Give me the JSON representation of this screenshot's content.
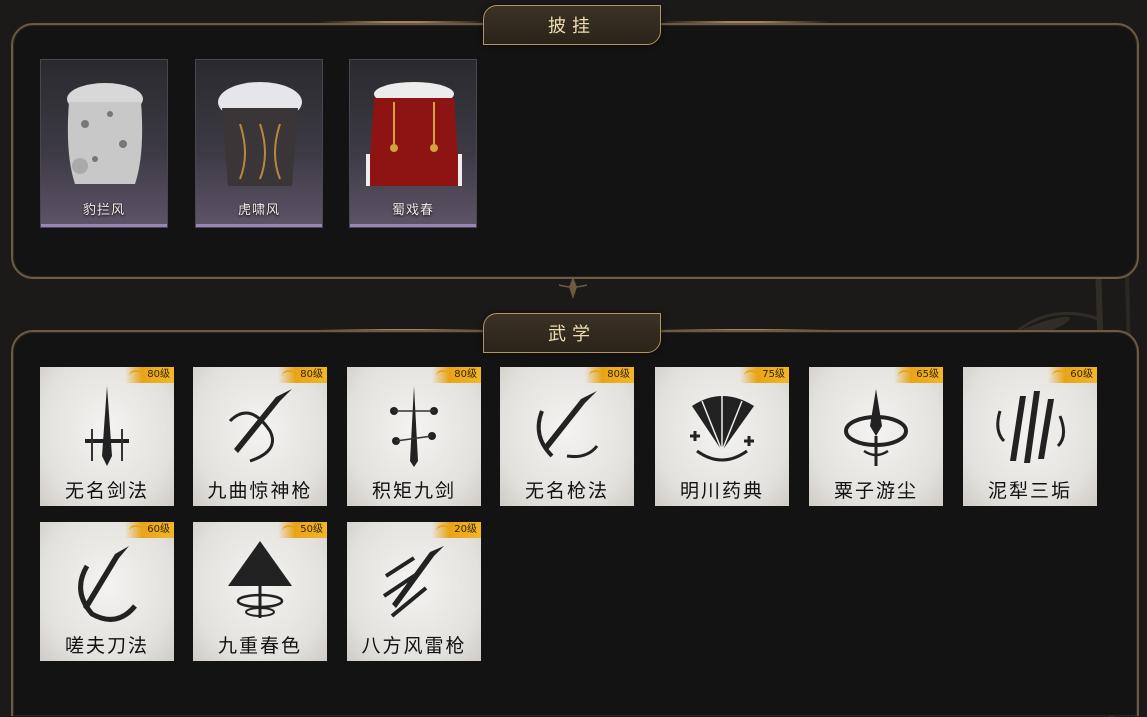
{
  "sections": {
    "capes": {
      "title": "披挂"
    },
    "skills": {
      "title": "武学"
    }
  },
  "capes": [
    {
      "name": "豹拦风",
      "icon": "snow-leopard-cape-icon"
    },
    {
      "name": "虎啸风",
      "icon": "tiger-cape-icon"
    },
    {
      "name": "蜀戏春",
      "icon": "red-opera-cape-icon"
    }
  ],
  "skills": [
    {
      "name": "无名剑法",
      "level": "80级",
      "icon": "sword-icon"
    },
    {
      "name": "九曲惊神枪",
      "level": "80级",
      "icon": "spear-swirl-icon"
    },
    {
      "name": "积矩九剑",
      "level": "80级",
      "icon": "constellation-sword-icon"
    },
    {
      "name": "无名枪法",
      "level": "80级",
      "icon": "spear-crescent-icon"
    },
    {
      "name": "明川药典",
      "level": "75级",
      "icon": "fan-icon"
    },
    {
      "name": "粟子游尘",
      "level": "65级",
      "icon": "swirl-blade-icon"
    },
    {
      "name": "泥犁三垢",
      "level": "60级",
      "icon": "triple-blade-icon"
    },
    {
      "name": "嗟夫刀法",
      "level": "60级",
      "icon": "blade-circle-icon"
    },
    {
      "name": "九重春色",
      "level": "50级",
      "icon": "umbrella-icon"
    },
    {
      "name": "八方风雷枪",
      "level": "20级",
      "icon": "wind-spear-icon"
    }
  ],
  "colors": {
    "accent_gold": "#b49460",
    "badge_gold": "#e8a416",
    "panel_border": "#6c5a42",
    "cape_bar": "#9b86b8"
  }
}
